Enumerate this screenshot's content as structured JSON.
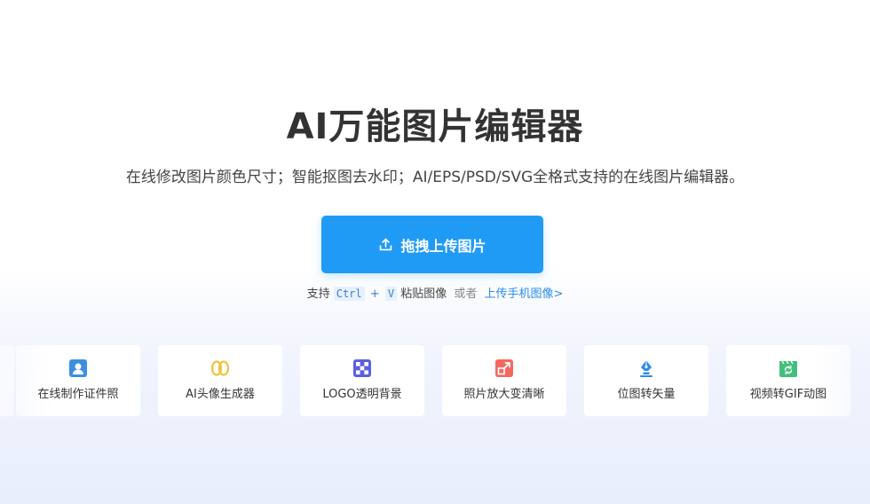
{
  "hero": {
    "title": "AI万能图片编辑器",
    "subtitle": "在线修改图片颜色尺寸；智能抠图去水印；AI/EPS/PSD/SVG全格式支持的在线图片编辑器。"
  },
  "upload": {
    "button_label": "拖拽上传图片",
    "icon": "upload-icon"
  },
  "hint": {
    "prefix": "支持",
    "key1": "Ctrl",
    "plus": "+",
    "key2": "V",
    "paste_text": "粘贴图像",
    "or_text": "或者",
    "mobile_link": "上传手机图像>"
  },
  "tools": [
    {
      "label": "在线制作证件照",
      "icon": "id-photo-icon",
      "color": "#3d8fe0"
    },
    {
      "label": "AI头像生成器",
      "icon": "ai-avatar-icon",
      "color": "#f0c23b"
    },
    {
      "label": "LOGO透明背景",
      "icon": "transparent-grid-icon",
      "color": "#5b5fe0"
    },
    {
      "label": "照片放大变清晰",
      "icon": "enlarge-icon",
      "color": "#f26a5f"
    },
    {
      "label": "位图转矢量",
      "icon": "pen-tool-icon",
      "color": "#2b8be6"
    },
    {
      "label": "视频转GIF动图",
      "icon": "gif-clapper-icon",
      "color": "#43c07a"
    }
  ]
}
